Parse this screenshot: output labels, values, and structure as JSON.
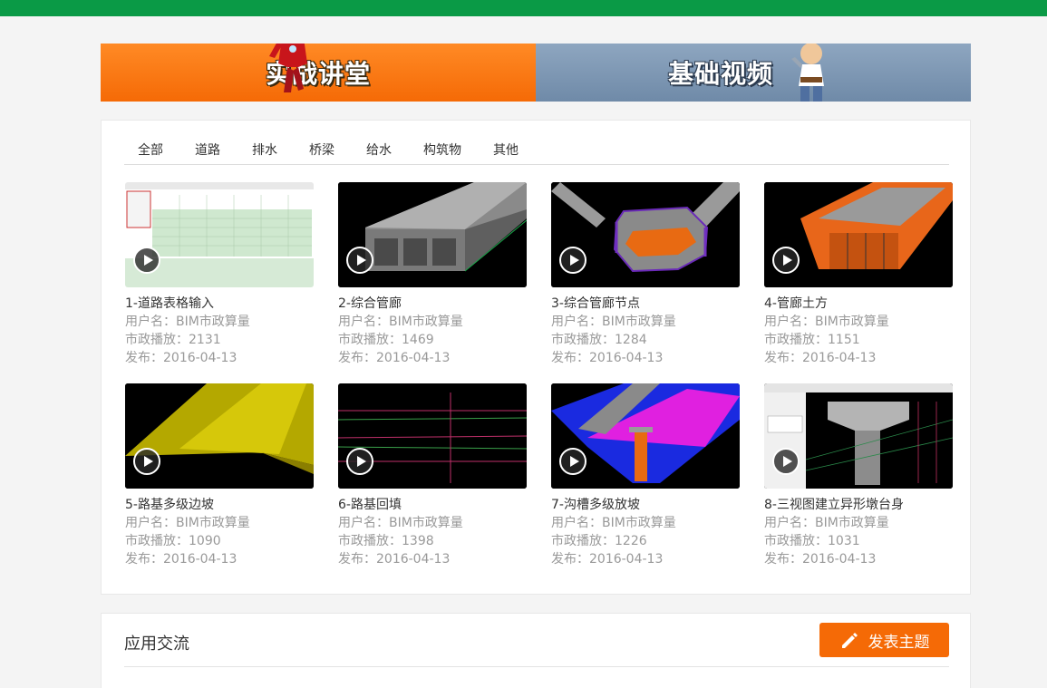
{
  "banner": {
    "practice_label": "实战讲堂",
    "basic_label": "基础视频",
    "colors": {
      "top_bar": "#0a9a46",
      "practice_bg": "#f56a06",
      "basic_bg": "#7b93ae"
    }
  },
  "categories": [
    "全部",
    "道路",
    "排水",
    "桥梁",
    "给水",
    "构筑物",
    "其他"
  ],
  "videos": [
    {
      "title": "1-道路表格输入",
      "user": "用户名：BIM市政算量",
      "plays": "市政播放：2131",
      "date": "发布：2016-04-13"
    },
    {
      "title": "2-综合管廊",
      "user": "用户名：BIM市政算量",
      "plays": "市政播放：1469",
      "date": "发布：2016-04-13"
    },
    {
      "title": "3-综合管廊节点",
      "user": "用户名：BIM市政算量",
      "plays": "市政播放：1284",
      "date": "发布：2016-04-13"
    },
    {
      "title": "4-管廊土方",
      "user": "用户名：BIM市政算量",
      "plays": "市政播放：1151",
      "date": "发布：2016-04-13"
    },
    {
      "title": "5-路基多级边坡",
      "user": "用户名：BIM市政算量",
      "plays": "市政播放：1090",
      "date": "发布：2016-04-13"
    },
    {
      "title": "6-路基回填",
      "user": "用户名：BIM市政算量",
      "plays": "市政播放：1398",
      "date": "发布：2016-04-13"
    },
    {
      "title": "7-沟槽多级放坡",
      "user": "用户名：BIM市政算量",
      "plays": "市政播放：1226",
      "date": "发布：2016-04-13"
    },
    {
      "title": "8-三视图建立异形墩台身",
      "user": "用户名：BIM市政算量",
      "plays": "市政播放：1031",
      "date": "发布：2016-04-13"
    }
  ],
  "forum": {
    "title": "应用交流",
    "post_button": "发表主题",
    "accent": "#f56a06"
  }
}
